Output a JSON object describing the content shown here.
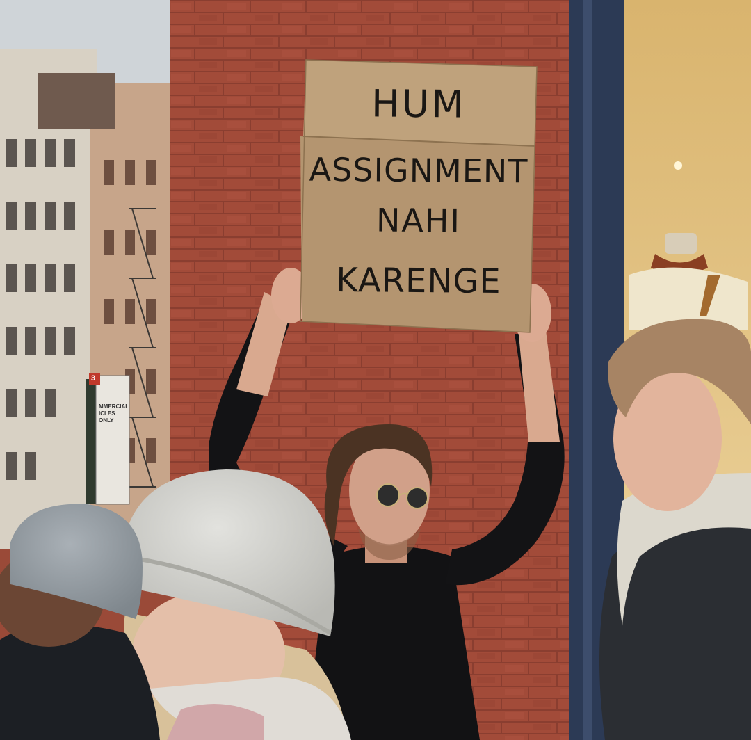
{
  "sign": {
    "line1": "HUM",
    "line2": "ASSIGNMENT",
    "line3": "NAHI",
    "line4": "KARENGE"
  },
  "street_sign": {
    "number": "3",
    "text": "MMERCIAL\nICLES ONLY"
  },
  "colors": {
    "brick": "#a24b39",
    "cardboard": "#b89a74",
    "sky": "#cfd4d8",
    "door_frame": "#2c3a55",
    "shop_window": "#e7c98c"
  }
}
